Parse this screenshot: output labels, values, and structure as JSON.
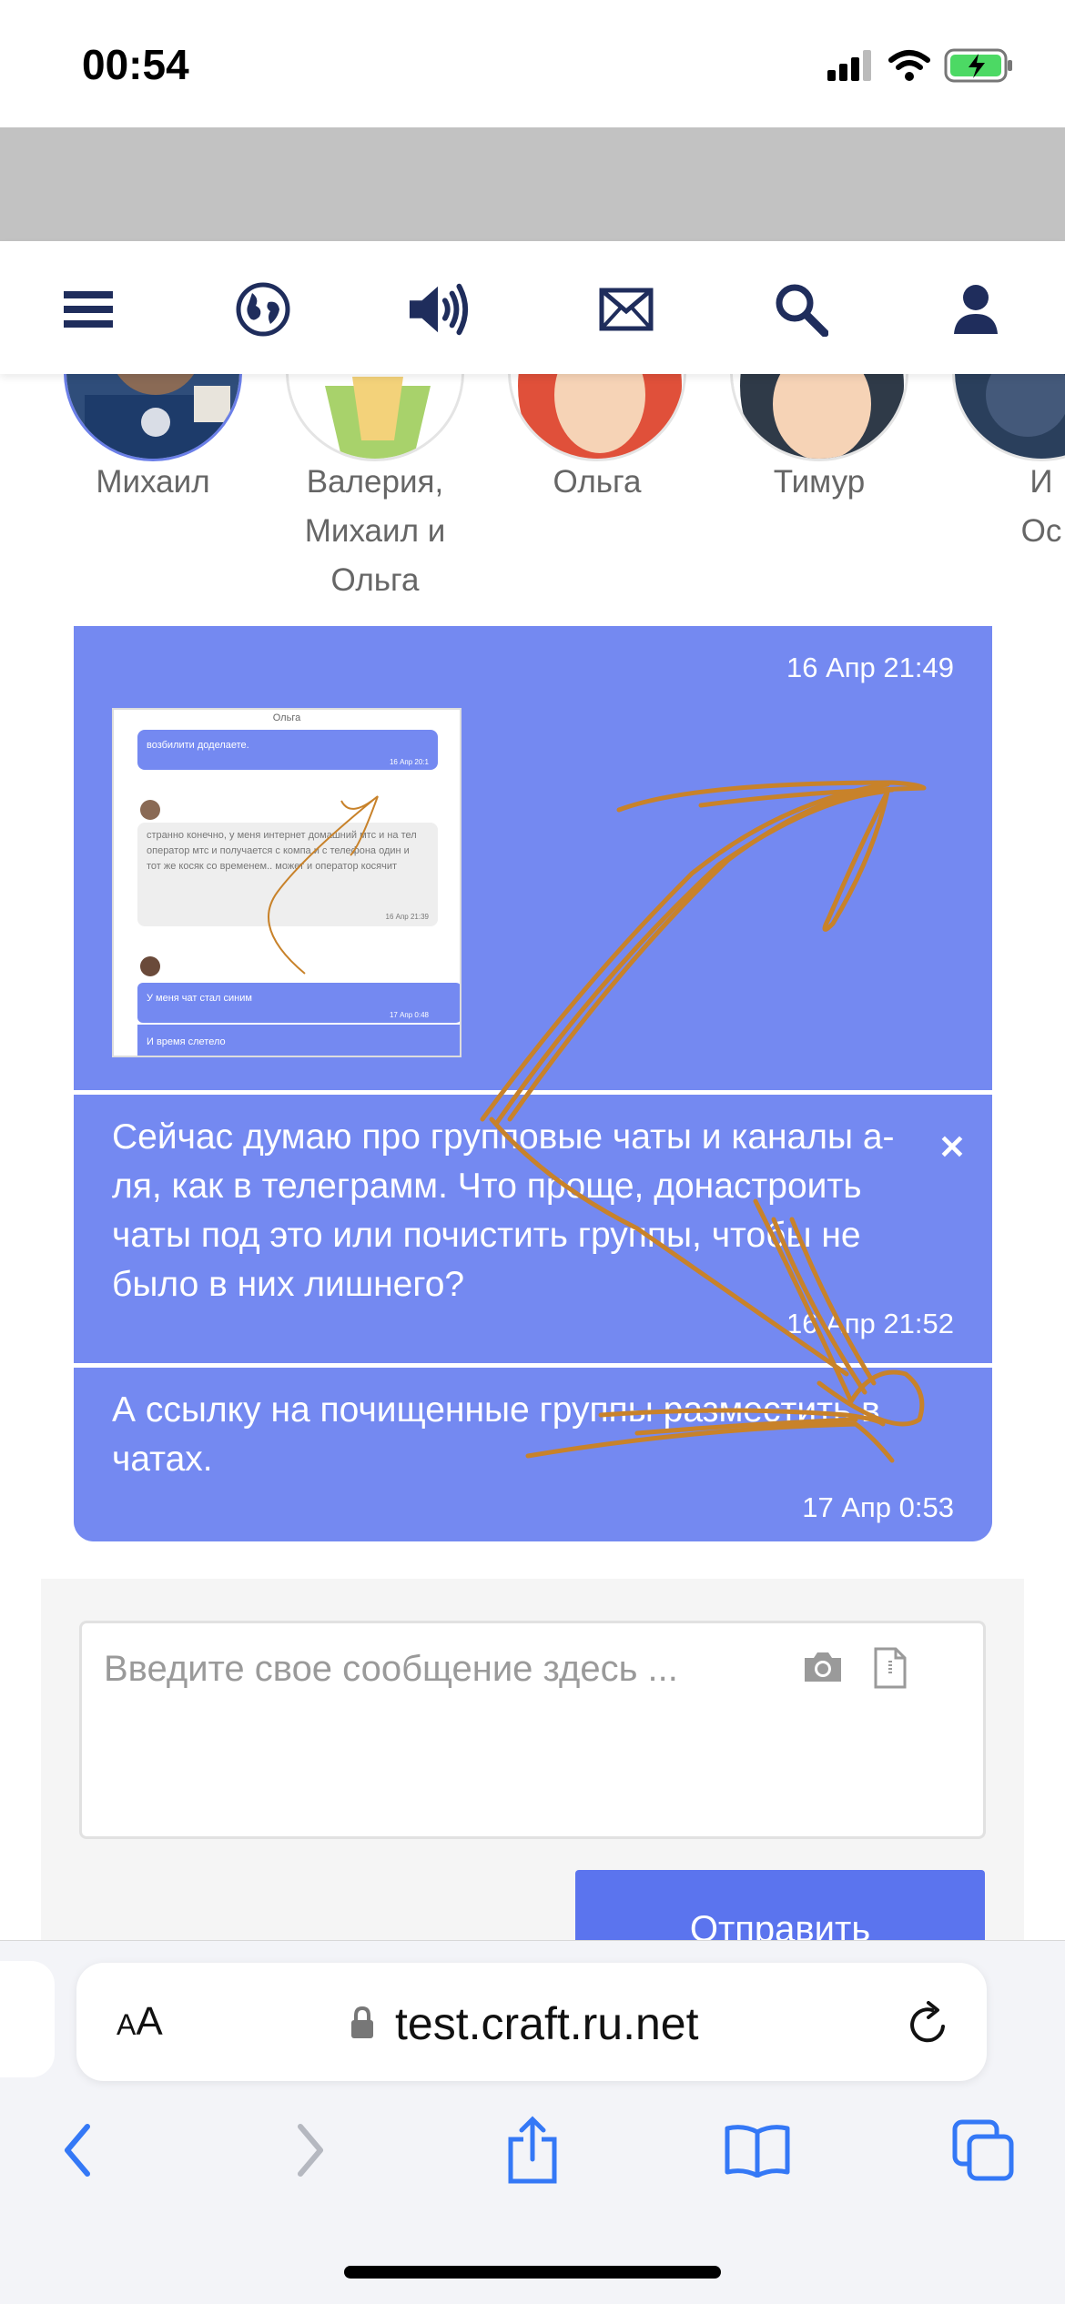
{
  "status_bar": {
    "time": "00:54"
  },
  "contacts": [
    {
      "name": "Михаил",
      "lines": [
        "Михаил"
      ]
    },
    {
      "name": "Валерия, Михаил и Ольга",
      "lines": [
        "Валерия,",
        "Михаил и",
        "Ольга"
      ]
    },
    {
      "name": "Ольга",
      "lines": [
        "Ольга"
      ]
    },
    {
      "name": "Тимур",
      "lines": [
        "Тимур"
      ]
    },
    {
      "name": "И Ос",
      "lines": [
        "И",
        "Ос"
      ]
    }
  ],
  "messages": [
    {
      "time": "16 Апр 21:49",
      "image_preview": {
        "header": "Ольга",
        "bubble1": "возбилити доделаете.",
        "bubble1_time": "16 Апр 20:1",
        "bubble2": "странно конечно, у меня интернет домашний мтс и на тел оператор мтс и получается с компа и с телефона один и тот же косяк со временем.. может и оператор косячит",
        "bubble2_time": "16 Апр 21:39",
        "bubble3": "У меня чат стал синим",
        "bubble3_time": "17 Апр 0:48",
        "bubble4": "И время слетело"
      }
    },
    {
      "text": "Сейчас думаю про групповые чаты и каналы а-ля, как в телеграмм. Что проще, донастроить чаты под это или почистить группы, чтобы не было в них лишнего?",
      "time": "16 Апр 21:52"
    },
    {
      "text": "А ссылку на почищенные группы разместить в чатах.",
      "time": "17 Апр 0:53"
    }
  ],
  "composer": {
    "placeholder": "Введите свое сообщение здесь ...",
    "send_label": "Отправить"
  },
  "browser": {
    "aa_label": "AA",
    "url": "test.craft.ru.net"
  },
  "colors": {
    "chat_bubble": "#7489f1",
    "send_button": "#5b74ee",
    "nav_icon": "#1f2d5c",
    "doodle": "#c8822a"
  }
}
